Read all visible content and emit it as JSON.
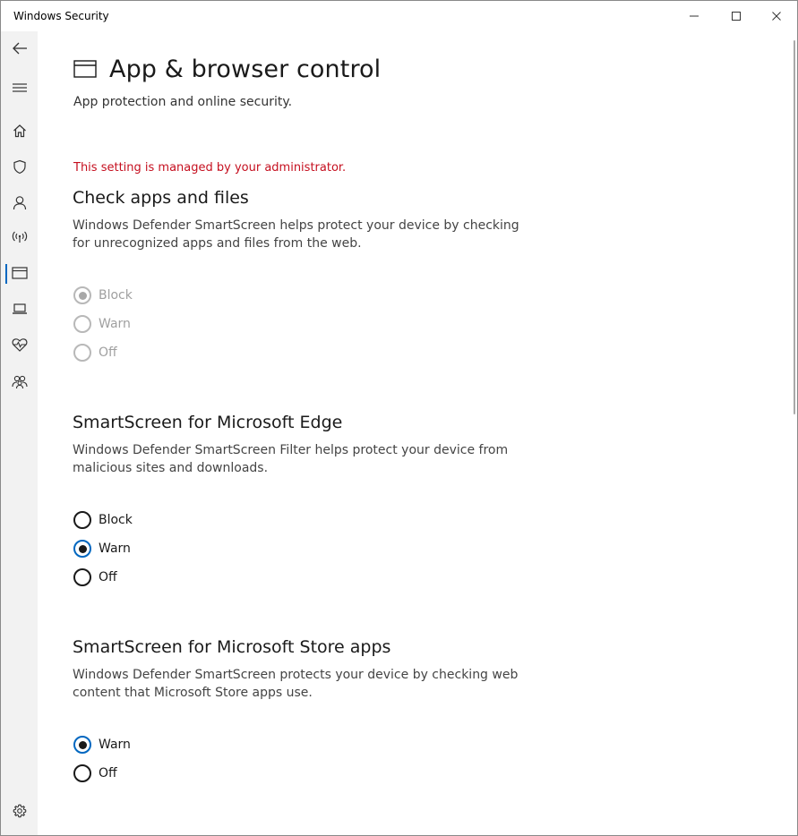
{
  "window": {
    "title": "Windows Security"
  },
  "sidebar": {
    "items": [
      {
        "name": "back",
        "icon": "back-arrow-icon"
      },
      {
        "name": "menu",
        "icon": "hamburger-menu-icon"
      },
      {
        "name": "home",
        "icon": "home-icon"
      },
      {
        "name": "virus-protection",
        "icon": "shield-icon"
      },
      {
        "name": "account-protection",
        "icon": "person-icon"
      },
      {
        "name": "firewall-network",
        "icon": "wireless-signal-icon"
      },
      {
        "name": "app-browser-control",
        "icon": "browser-window-icon",
        "active": true
      },
      {
        "name": "device-security",
        "icon": "laptop-icon"
      },
      {
        "name": "device-performance",
        "icon": "heart-pulse-icon"
      },
      {
        "name": "family-options",
        "icon": "family-icon"
      },
      {
        "name": "settings",
        "icon": "gear-icon"
      }
    ]
  },
  "page": {
    "title": "App & browser control",
    "subtitle": "App protection and online security.",
    "admin_note": "This setting is managed by your administrator."
  },
  "sections": [
    {
      "title": "Check apps and files",
      "description": "Windows Defender SmartScreen helps protect your device by checking for unrecognized apps and files from the web.",
      "options": [
        "Block",
        "Warn",
        "Off"
      ],
      "selected": "Block",
      "disabled": true
    },
    {
      "title": "SmartScreen for Microsoft Edge",
      "description": "Windows Defender SmartScreen Filter helps protect your device from malicious sites and downloads.",
      "options": [
        "Block",
        "Warn",
        "Off"
      ],
      "selected": "Warn",
      "disabled": false
    },
    {
      "title": "SmartScreen for Microsoft Store apps",
      "description": "Windows Defender SmartScreen protects your device by checking web content that Microsoft Store apps use.",
      "options": [
        "Warn",
        "Off"
      ],
      "selected": "Warn",
      "disabled": false
    }
  ],
  "colors": {
    "accent": "#0067c0",
    "admin_note": "#c50f1f",
    "sidebar_bg": "#f2f2f2",
    "disabled": "#a0a0a0"
  }
}
